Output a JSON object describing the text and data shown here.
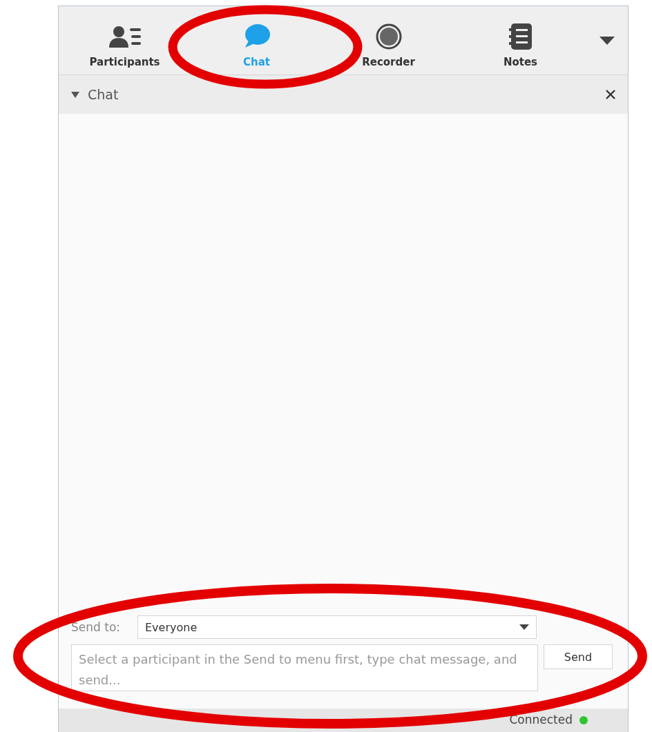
{
  "tabs": [
    {
      "kind": "participants",
      "label": "Participants",
      "selected": false
    },
    {
      "kind": "chat",
      "label": "Chat",
      "selected": true
    },
    {
      "kind": "recorder",
      "label": "Recorder",
      "selected": false
    },
    {
      "kind": "notes",
      "label": "Notes",
      "selected": false
    }
  ],
  "panel": {
    "title": "Chat",
    "expanded": true
  },
  "compose": {
    "send_to_label": "Send to:",
    "recipient": "Everyone",
    "placeholder": "Select a participant in the Send to menu first, type chat message, and send...",
    "send_button": "Send"
  },
  "status_bar": {
    "status": "Connected",
    "connected": true
  }
}
